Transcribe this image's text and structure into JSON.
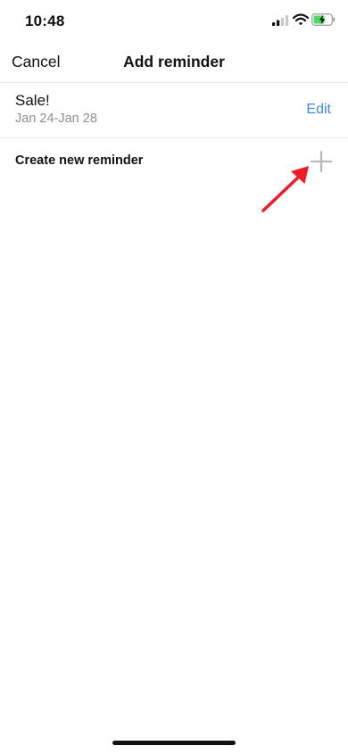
{
  "status_bar": {
    "time": "10:48",
    "icons": [
      "signal-icon",
      "wifi-icon",
      "battery-icon"
    ]
  },
  "nav": {
    "cancel_label": "Cancel",
    "title": "Add reminder"
  },
  "reminder": {
    "title": "Sale!",
    "dates": "Jan 24-Jan 28",
    "edit_label": "Edit"
  },
  "create": {
    "label": "Create new reminder",
    "icon": "plus-icon"
  },
  "colors": {
    "accent": "#3d8ae0",
    "annotation": "#ee1c2b",
    "battery_fill": "#4cd964",
    "plus_icon": "#b8b8b8"
  }
}
